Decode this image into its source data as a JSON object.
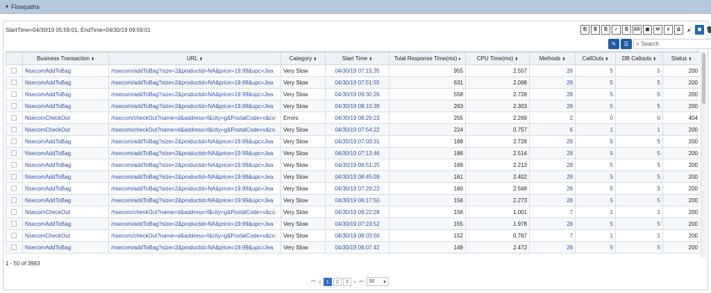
{
  "panel": {
    "toggle_icon": "▾",
    "title": "Flowpaths"
  },
  "time_range": "StartTime=04/30/19 05:59:01, EndTime=04/30/19 09:59:01",
  "toolbar_icons": [
    {
      "name": "export-pdf-icon",
      "glyph": "⎘"
    },
    {
      "name": "export-chart-icon",
      "glyph": "⎘"
    },
    {
      "name": "export-report-icon",
      "glyph": "⎘"
    },
    {
      "name": "export-checked-icon",
      "glyph": "✓"
    },
    {
      "name": "export-text-icon",
      "glyph": "⎘"
    },
    {
      "name": "ed-icon",
      "glyph": "ED"
    },
    {
      "name": "table-view-icon",
      "glyph": "▦"
    },
    {
      "name": "word-icon",
      "glyph": "W"
    },
    {
      "name": "excel-icon",
      "glyph": "X"
    },
    {
      "name": "pdf-icon",
      "glyph": "⎙"
    },
    {
      "name": "zoom-icon",
      "glyph": "⌕"
    },
    {
      "name": "grid-icon",
      "glyph": "▦"
    },
    {
      "name": "delete-icon",
      "glyph": "🗑"
    }
  ],
  "controls": {
    "edit_icon": "✎",
    "columns_icon": "☰",
    "search_icon": "⌕",
    "search_placeholder": "Search"
  },
  "table": {
    "columns": [
      "",
      "Business Transaction",
      "URL",
      "Category",
      "Start Time",
      "Total Response Time(ms)",
      "CPU Time(ms)",
      "Methods",
      "CallOuts",
      "DB Callouts",
      "Status"
    ],
    "sort_glyphs": [
      "",
      "⬍",
      "⬍",
      "⬍",
      "⬍",
      "▾",
      "⬍",
      "⬍",
      "⬍",
      "⬍",
      "⬍"
    ],
    "rows": [
      [
        "NsecomAddToBag",
        "/nsecom/addToBag?size=2&productid=NA&price=19.99&upc=Jea",
        "Very Slow",
        "04/30/19 07:15:35",
        "955",
        "2.557",
        "28",
        "5",
        "5",
        "200"
      ],
      [
        "NsecomAddToBag",
        "/nsecom/addToBag?size=2&productid=NA&price=19.99&upc=Jea",
        "Very Slow",
        "04/30/19 07:51:55",
        "631",
        "2.098",
        "28",
        "5",
        "5",
        "200"
      ],
      [
        "NsecomAddToBag",
        "/nsecom/addToBag?size=2&productid=NA&price=19.99&upc=Jea",
        "Very Slow",
        "04/30/19 09:30:26",
        "558",
        "2.728",
        "28",
        "5",
        "5",
        "200"
      ],
      [
        "NsecomAddToBag",
        "/nsecom/addToBag?size=2&productid=NA&price=19.99&upc=Jea",
        "Very Slow",
        "04/30/19 09:10:39",
        "263",
        "2.303",
        "28",
        "5",
        "5",
        "200"
      ],
      [
        "NsecomCheckOut",
        "/nsecom/checkOut?name=d&address=f&city=g&PostalCode=v&co",
        "Errors",
        "04/30/19 08:29:23",
        "255",
        "2.269",
        "2",
        "0",
        "0",
        "404"
      ],
      [
        "NsecomCheckOut",
        "/nsecom/checkOut?name=d&address=f&city=g&PostalCode=v&co",
        "Very Slow",
        "04/30/19 07:54:22",
        "224",
        "0.757",
        "6",
        "1",
        "1",
        "200"
      ],
      [
        "NsecomAddToBag",
        "/nsecom/addToBag?size=2&productid=NA&price=19.99&upc=Jea",
        "Very Slow",
        "04/30/19 07:03:31",
        "188",
        "2.728",
        "28",
        "5",
        "5",
        "200"
      ],
      [
        "NsecomAddToBag",
        "/nsecom/addToBag?size=2&productid=NA&price=19.99&upc=Jea",
        "Very Slow",
        "04/30/19 07:13:46",
        "186",
        "2.514",
        "28",
        "5",
        "5",
        "200"
      ],
      [
        "NsecomAddToBag",
        "/nsecom/addToBag?size=2&productid=NA&price=19.99&upc=Jea",
        "Very Slow",
        "04/30/19 09:51:25",
        "169",
        "2.213",
        "28",
        "5",
        "5",
        "200"
      ],
      [
        "NsecomAddToBag",
        "/nsecom/addToBag?size=2&productid=NA&price=19.99&upc=Jea",
        "Very Slow",
        "04/30/19 08:45:09",
        "161",
        "2.402",
        "28",
        "5",
        "5",
        "200"
      ],
      [
        "NsecomAddToBag",
        "/nsecom/addToBag?size=2&productid=NA&price=19.99&upc=Jea",
        "Very Slow",
        "04/30/19 07:29:23",
        "160",
        "2.568",
        "28",
        "5",
        "5",
        "200"
      ],
      [
        "NsecomAddToBag",
        "/nsecom/addToBag?size=2&productid=NA&price=19.99&upc=Jea",
        "Very Slow",
        "04/30/19 06:17:50",
        "156",
        "2.273",
        "28",
        "5",
        "5",
        "200"
      ],
      [
        "NsecomCheckOut",
        "/nsecom/checkOut?name=d&address=f&city=g&PostalCode=v&co",
        "Very Slow",
        "04/30/19 09:22:28",
        "156",
        "1.001",
        "7",
        "1",
        "1",
        "200"
      ],
      [
        "NsecomAddToBag",
        "/nsecom/addToBag?size=2&productid=NA&price=19.99&upc=Jea",
        "Very Slow",
        "04/30/19 07:23:52",
        "155",
        "1.978",
        "28",
        "5",
        "5",
        "200"
      ],
      [
        "NsecomCheckOut",
        "/nsecom/checkOut?name=d&address=f&city=g&PostalCode=v&co",
        "Very Slow",
        "04/30/19 08:03:56",
        "152",
        "0.767",
        "7",
        "1",
        "1",
        "200"
      ],
      [
        "NsecomAddToBag",
        "/nsecom/addToBag?size=2&productid=NA&price=19.99&upc=Jea",
        "Very Slow",
        "04/30/19 06:07:42",
        "149",
        "2.472",
        "28",
        "5",
        "5",
        "200"
      ]
    ]
  },
  "record_count": "1 - 50 of 3983",
  "pager": {
    "first": "⏮",
    "prev": "◂",
    "next": "▸",
    "last": "⏭",
    "pages": [
      "1",
      "2",
      "3"
    ],
    "active_page": "1",
    "page_size": "50",
    "page_size_caret": "▾"
  }
}
